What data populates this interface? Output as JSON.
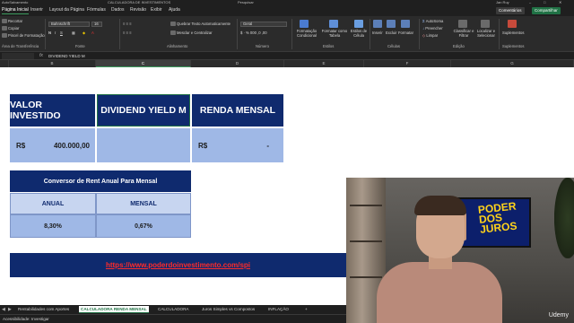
{
  "titlebar": {
    "autosave": "AutoSalvamento",
    "filename": "CALCULADORA DE INVESTIMENTOS",
    "search_placeholder": "Pesquisar",
    "user": "Jan Ruy"
  },
  "tabs": [
    "Página Inicial",
    "Inserir",
    "Layout da Página",
    "Fórmulas",
    "Dados",
    "Revisão",
    "Exibir",
    "Ajuda"
  ],
  "top_buttons": {
    "comments": "Comentários",
    "share": "Compartilhar"
  },
  "ribbon": {
    "clipboard": {
      "recortar": "Recortar",
      "copiar": "Copiar",
      "pincel": "Pincel de Formatação",
      "label": "Área de Transferência"
    },
    "font": {
      "name": "Bahnschrift",
      "size": "16",
      "label": "Fonte"
    },
    "alignment": {
      "wrap": "Quebrar Texto Automaticamente",
      "merge": "Mesclar e Centralizar",
      "label": "Alinhamento"
    },
    "number": {
      "format": "Geral",
      "label": "Número"
    },
    "styles": {
      "conditional": "Formatação Condicional",
      "as_table": "Formatar como Tabela",
      "cell_styles": "Estilos de Célula",
      "label": "Estilos"
    },
    "cells": {
      "insert": "Inserir",
      "delete": "Excluir",
      "format": "Formatar",
      "label": "Células"
    },
    "editing": {
      "autosum": "AutoSoma",
      "fill": "Preencher",
      "clear": "Limpar",
      "sort": "Classificar e Filtrar",
      "find": "Localizar e Selecionar",
      "label": "Edição"
    },
    "addins": {
      "label": "Suplementos",
      "btn": "Suplementos"
    }
  },
  "formula_bar": {
    "namebox": "",
    "fx": "fx",
    "content": "DIVIDEND YIELD M"
  },
  "columns": [
    "B",
    "C",
    "D",
    "E",
    "F",
    "G"
  ],
  "sheet": {
    "headers": [
      "VALOR INVESTIDO",
      "DIVIDEND YIELD M",
      "RENDA MENSAL"
    ],
    "row1": {
      "invested_currency": "R$",
      "invested_value": "400.000,00",
      "yield": "",
      "income_currency": "R$",
      "income_value": "-"
    },
    "converter": {
      "title": "Conversor de Rent Anual Para Mensal",
      "annual_label": "ANUAL",
      "monthly_label": "MENSAL",
      "annual_value": "8,30%",
      "monthly_value": "0,67%"
    },
    "link": "https://www.poderdoinvestimento.com/spi"
  },
  "webcam": {
    "brand": "Udemy",
    "tv_text": "PODER DOS JUROS"
  },
  "sheet_tabs": [
    "Rentabilidades com Aportes",
    "CALCULADORA RENDA MENSAL",
    "CALCULADORA",
    "Juros Simples vs Compostos",
    "INFLAÇÃO",
    "+"
  ],
  "active_sheet_tab": "CALCULADORA RENDA MENSAL",
  "status": {
    "accessibility": "Acessibilidade: Investigar"
  },
  "colors": {
    "navy": "#0f2a6e",
    "light_blue": "#9fb8e6",
    "excel_green": "#207245",
    "link_red": "#ff2a2a"
  }
}
